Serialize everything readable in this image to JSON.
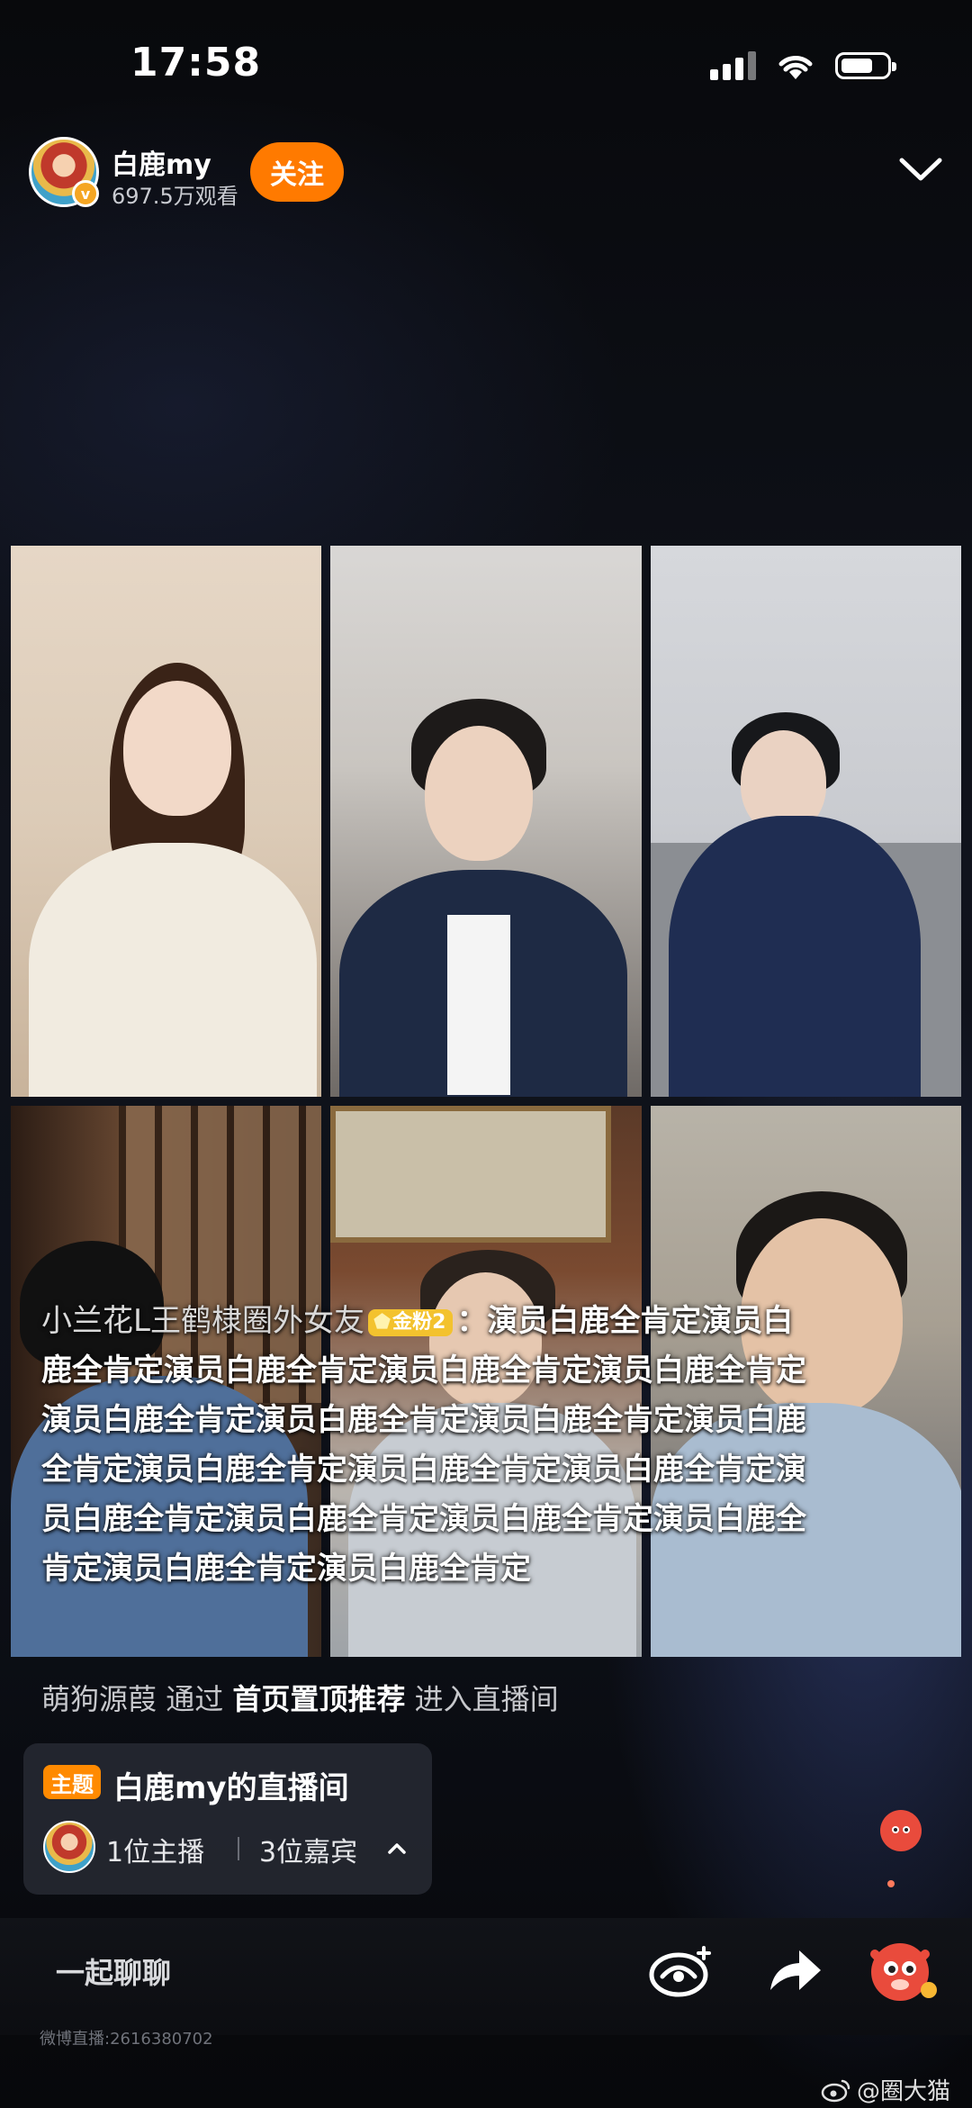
{
  "status_bar": {
    "time": "17:58",
    "signal_icon": "signal-bars-icon",
    "wifi_icon": "wifi-icon",
    "battery_icon": "battery-icon",
    "battery_level": 0.7
  },
  "header": {
    "host_name": "白鹿my",
    "views": "697.5万观看",
    "verify_badge": "v",
    "follow_label": "关注",
    "collapse_icon": "chevron-down-icon"
  },
  "video_grid": {
    "tiles": 6
  },
  "comment": {
    "username": "小兰花L王鹤棣圈外女友",
    "fan_badge": "金粉2",
    "separator": "：",
    "text": "演员白鹿全肯定演员白鹿全肯定演员白鹿全肯定演员白鹿全肯定演员白鹿全肯定演员白鹿全肯定演员白鹿全肯定演员白鹿全肯定演员白鹿全肯定演员白鹿全肯定演员白鹿全肯定演员白鹿全肯定演员白鹿全肯定演员白鹿全肯定演员白鹿全肯定演员白鹿全肯定演员白鹿全肯定演员白鹿全肯定"
  },
  "entry_notice": {
    "user": "萌狗源葭",
    "via": "通过",
    "source": "首页置顶推荐",
    "action": "进入直播间"
  },
  "topic_card": {
    "tag": "主题",
    "title": "白鹿my的直播间",
    "host_count": "1位主播",
    "guest_count": "3位嘉宾",
    "expand_icon": "chevron-up-icon"
  },
  "bottom_bar": {
    "chat_placeholder": "一起聊聊",
    "gift_icon": "gift-icon",
    "share_icon": "share-arrow-icon",
    "mascot_icon": "mascot-icon",
    "stream_id": "微博直播:2616380702"
  },
  "watermark": {
    "logo_icon": "weibo-logo-icon",
    "text": "@圈大猫"
  },
  "colors": {
    "accent": "#ff7a00",
    "fan_badge": "#f3c22e",
    "background": "#0b0c10"
  }
}
